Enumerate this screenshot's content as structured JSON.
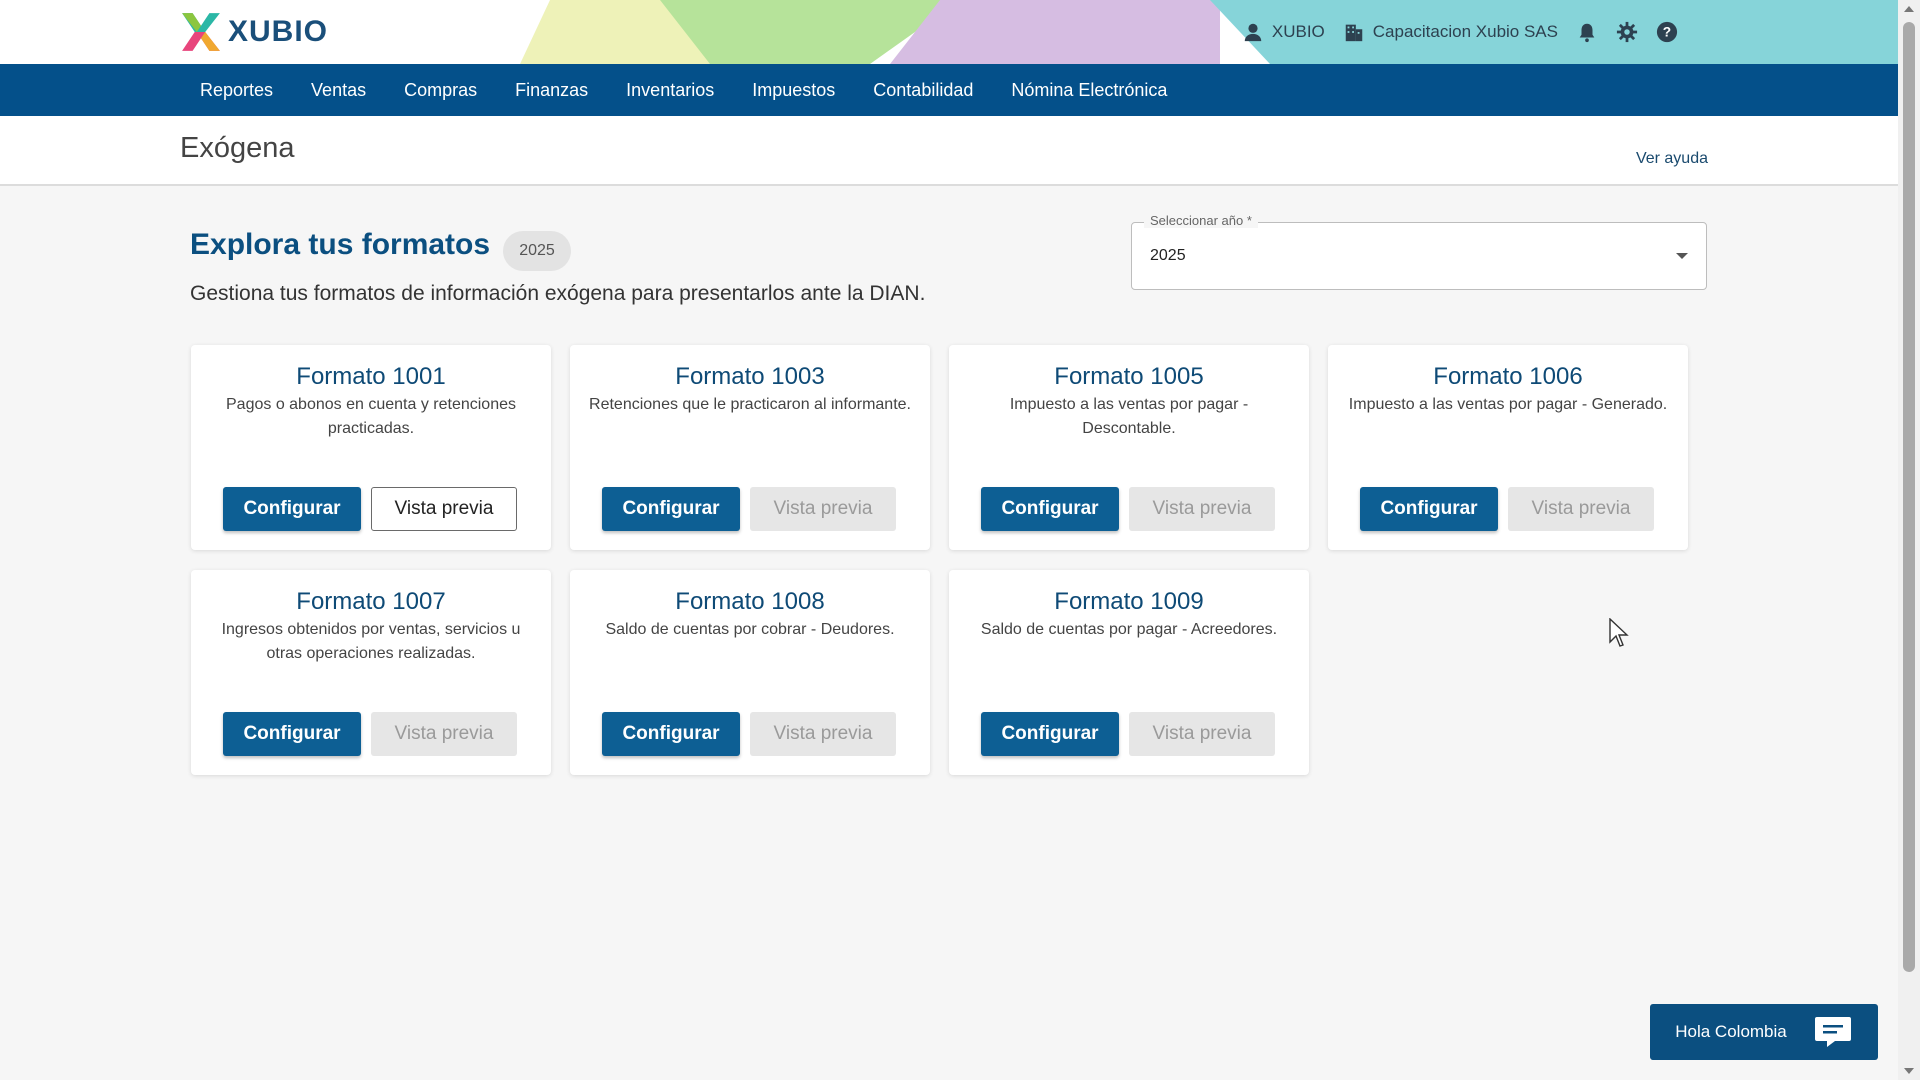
{
  "brand": {
    "name": "XUBIO",
    "primary_color": "#04508a",
    "accent_color": "#0d5f94"
  },
  "topbar": {
    "user_name": "XUBIO",
    "company_name": "Capacitacion Xubio SAS",
    "icons": [
      "user-icon",
      "building-icon",
      "bell-icon",
      "gear-icon",
      "help-icon"
    ]
  },
  "nav": {
    "items": [
      {
        "label": "Reportes"
      },
      {
        "label": "Ventas"
      },
      {
        "label": "Compras"
      },
      {
        "label": "Finanzas"
      },
      {
        "label": "Inventarios"
      },
      {
        "label": "Impuestos"
      },
      {
        "label": "Contabilidad"
      },
      {
        "label": "Nómina Electrónica"
      }
    ]
  },
  "page": {
    "title": "Exógena",
    "help_link": "Ver ayuda"
  },
  "intro": {
    "title": "Explora tus formatos",
    "year_chip": "2025",
    "subtitle": "Gestiona tus formatos de información exógena para presentarlos ante la DIAN."
  },
  "year_select": {
    "label": "Seleccionar año *",
    "value": "2025"
  },
  "cards": [
    {
      "title": "Formato 1001",
      "desc": "Pagos o abonos en cuenta y retenciones practicadas.",
      "config_label": "Configurar",
      "preview_label": "Vista previa",
      "preview_enabled": true
    },
    {
      "title": "Formato 1003",
      "desc": "Retenciones que le practicaron al informante.",
      "config_label": "Configurar",
      "preview_label": "Vista previa",
      "preview_enabled": false
    },
    {
      "title": "Formato 1005",
      "desc": "Impuesto a las ventas por pagar - Descontable.",
      "config_label": "Configurar",
      "preview_label": "Vista previa",
      "preview_enabled": false
    },
    {
      "title": "Formato 1006",
      "desc": "Impuesto a las ventas por pagar - Generado.",
      "config_label": "Configurar",
      "preview_label": "Vista previa",
      "preview_enabled": false
    },
    {
      "title": "Formato 1007",
      "desc": "Ingresos obtenidos por ventas, servicios u otras operaciones realizadas.",
      "config_label": "Configurar",
      "preview_label": "Vista previa",
      "preview_enabled": false
    },
    {
      "title": "Formato 1008",
      "desc": "Saldo de cuentas por cobrar - Deudores.",
      "config_label": "Configurar",
      "preview_label": "Vista previa",
      "preview_enabled": false
    },
    {
      "title": "Formato 1009",
      "desc": "Saldo de cuentas por pagar - Acreedores.",
      "config_label": "Configurar",
      "preview_label": "Vista previa",
      "preview_enabled": false
    }
  ],
  "chat": {
    "label": "Hola Colombia",
    "icon": "chat-icon"
  }
}
